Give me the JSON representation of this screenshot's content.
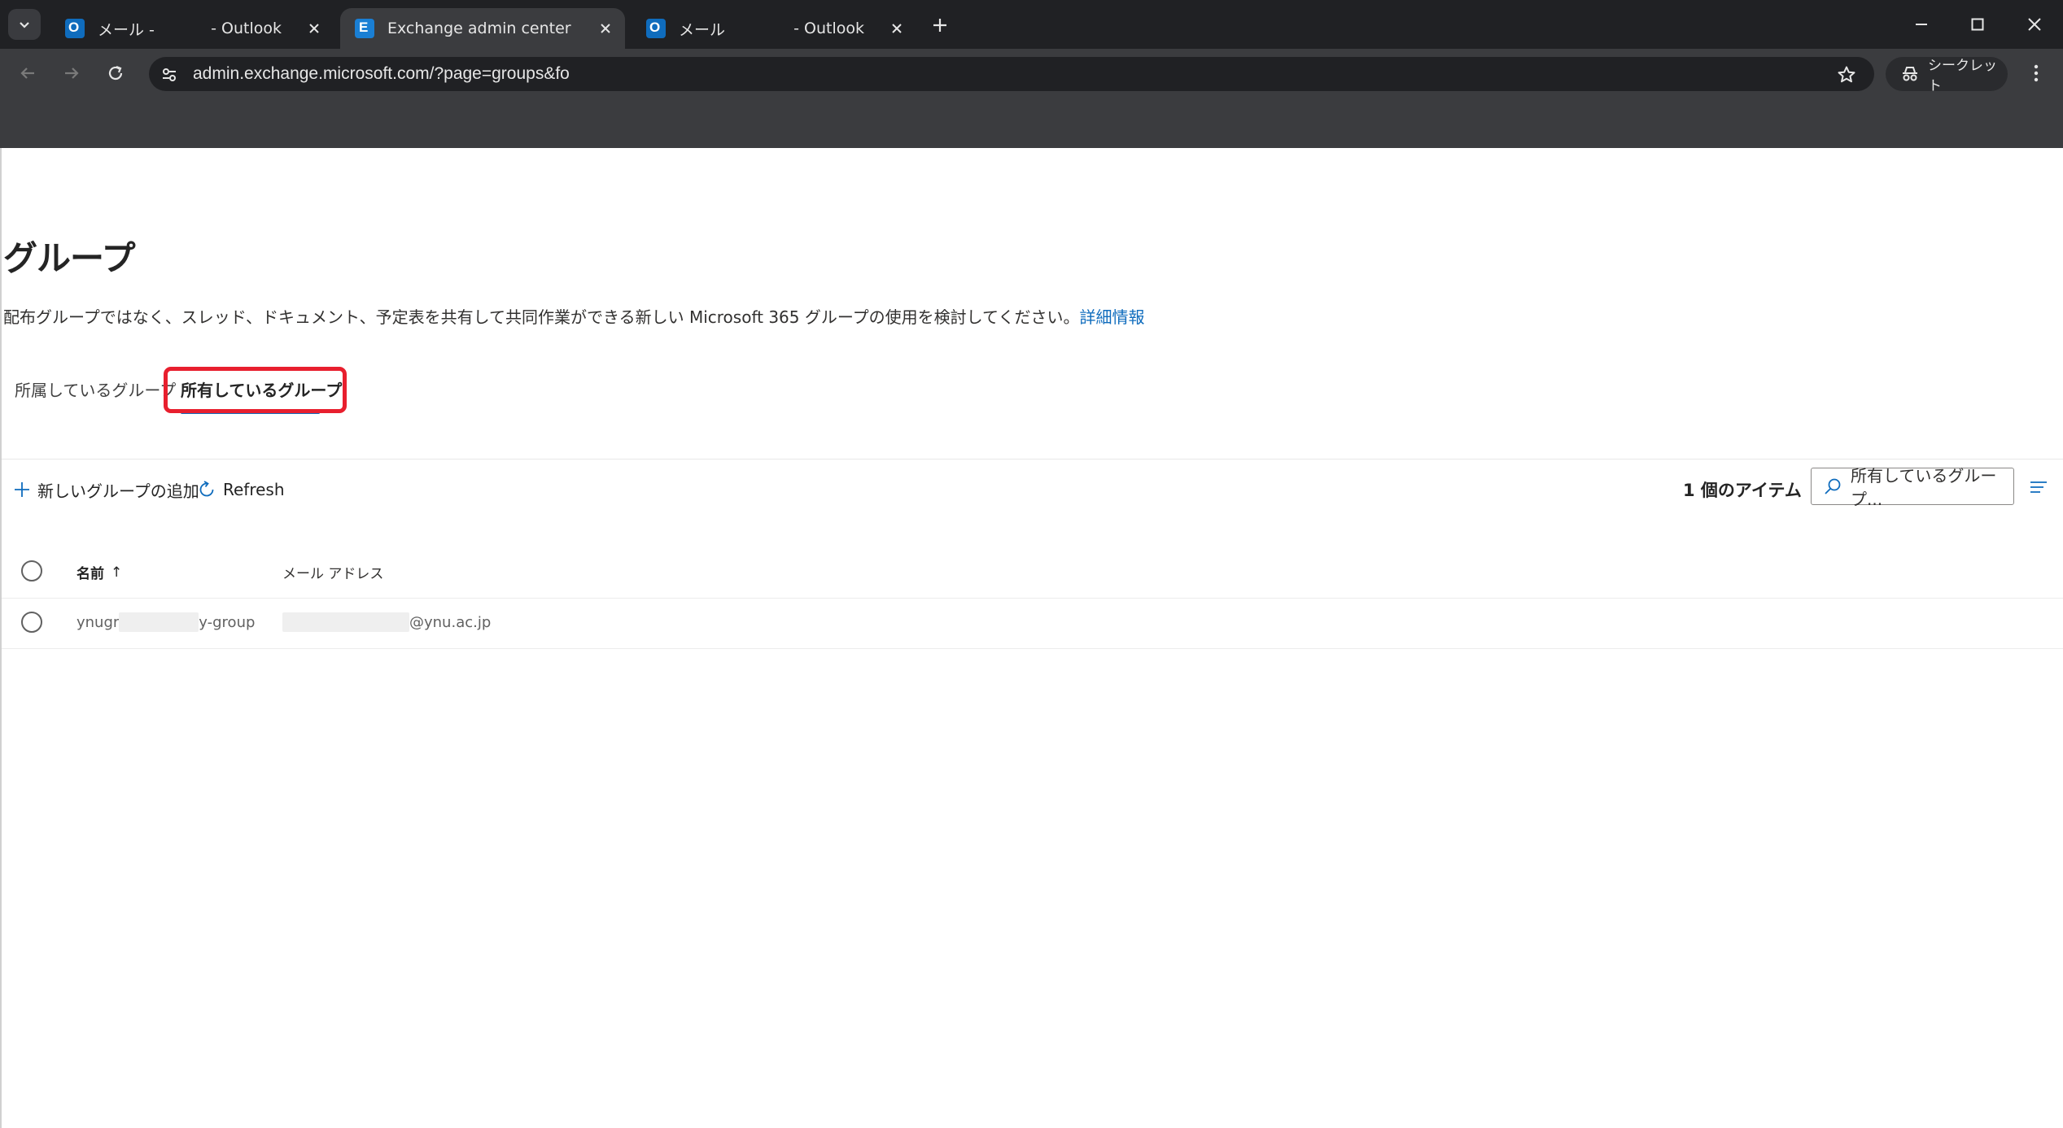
{
  "browser": {
    "tabs": [
      {
        "title": "メール -",
        "suffix": "- Outlook",
        "icon": "outlook-icon",
        "active": false
      },
      {
        "title": "Exchange admin center",
        "suffix": "",
        "icon": "exchange-icon",
        "active": true
      },
      {
        "title": "メール",
        "suffix": "- Outlook",
        "icon": "outlook-icon",
        "active": false
      }
    ],
    "url": "admin.exchange.microsoft.com/?page=groups&fo",
    "incognito_label": "シークレット",
    "colors": {
      "chrome_dark": "#202124",
      "chrome_toolbar": "#3b3c3f"
    }
  },
  "page": {
    "title": "グループ",
    "description": "配布グループではなく、スレッド、ドキュメント、予定表を共有して共同作業ができる新しい Microsoft 365 グループの使用を検討してください。",
    "learn_more": "詳細情報",
    "tabs": [
      "所属しているグループ",
      "所有しているグループ"
    ],
    "selected_tab": "所有しているグループ",
    "commands": {
      "add": "新しいグループの追加",
      "refresh": "Refresh"
    },
    "item_count": "1 個のアイテム",
    "search_placeholder": "所有しているグループ...",
    "table": {
      "headers": {
        "name": "名前",
        "email": "メール アドレス"
      },
      "sort_indicator": "↑",
      "rows": [
        {
          "name_prefix": "ynugr",
          "name_suffix": "y-group",
          "email_suffix": "@ynu.ac.jp"
        }
      ]
    },
    "colors": {
      "accent": "#0f6cbd",
      "highlight": "#e81f2e"
    }
  }
}
